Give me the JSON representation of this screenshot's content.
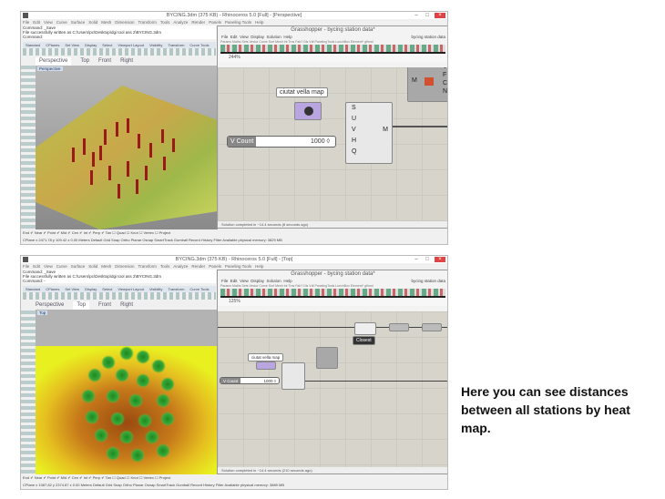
{
  "top": {
    "title": "BYCING.3dm (375 KB) - Rhinoceros 5.0 [Full] - [Perspective]",
    "menu": [
      "File",
      "Edit",
      "View",
      "Curve",
      "Surface",
      "Solid",
      "Mesh",
      "Dimension",
      "Transform",
      "Tools",
      "Analyze",
      "Render",
      "Panels",
      "Paneling Tools",
      "Help"
    ],
    "command_lines": [
      "Command: _Save",
      "File successfully written as C:\\Users\\pc\\Desktop\\dgi tool ass 2\\BYCING.3dm",
      "Command:"
    ],
    "toolbar_tabs": [
      "Standard",
      "CPlanes",
      "Set View",
      "Display",
      "Select",
      "Viewport Layout",
      "Visibility",
      "Transform",
      "Curve Tools"
    ],
    "viewport_tabs": [
      "Perspective",
      "Top",
      "Front",
      "Right"
    ],
    "viewport_label": "Perspective",
    "osnap": [
      "End",
      "Near",
      "Point",
      "Mid",
      "Cen",
      "Int",
      "Perp",
      "Tan",
      "Quad",
      "Knot",
      "Vertex",
      "Project"
    ],
    "status": "CPlane  x 2471.78  y 109.42   z 0.00     Meters   Default        Grid Snap  Ortho  Planar  Osnap  SmartTrack  Gumball  Record History  Filter  Available physical memory: 3829 MB",
    "gh": {
      "title": "Grasshopper - bycing station data*",
      "menu": [
        "File",
        "Edit",
        "View",
        "Display",
        "Solution",
        "Help"
      ],
      "doc_name": "bycing station data",
      "tabs": "Params  Maths  Sets  Vector  Curve  Surf  Mesh  Int  Trns  Fab?  Dis  Vdt  PanelingTools  LunchBox  Element*  gHowl",
      "zoom": "244%",
      "panel_text": "ciutat vella map",
      "slider_label": "V Count",
      "slider_value": "1000 ◊",
      "inputs": [
        "S",
        "U",
        "V",
        "H",
        "Q"
      ],
      "output": "M",
      "node2_outputs": [
        "V",
        "F",
        "C",
        "N"
      ],
      "node2_input": "M",
      "status": "Solution completed in ~14.4 seconds (8 seconds ago)"
    }
  },
  "bottom": {
    "title": "BYCING.3dm (375 KB) - Rhinoceros 5.0 [Full] - [Top]",
    "command_lines": [
      "Command: _Save",
      "File successfully written as C:\\Users\\pc\\Desktop\\dgi tool ass 2\\BYCING.3dm",
      "Command: -"
    ],
    "viewport_label": "Top",
    "status": "CPlane  x 1087.82  y 2374.87   z 0.00     Meters   Default        Grid Snap  Ortho  Planar  Osnap  SmartTrack  Gumball  Record History  Filter  Available physical memory: 3889 MB",
    "gh": {
      "title": "Grasshopper - bycing station data*",
      "zoom": "125%",
      "panel_text": "ciutat vella map",
      "slider_label": "V Count",
      "slider_value": "1000 ◊",
      "tooltip": "Closest",
      "status": "Solution completed in ~14.4 seconds (210 seconds ago)"
    }
  },
  "caption": "Here you can see distances between all stations by heat map."
}
